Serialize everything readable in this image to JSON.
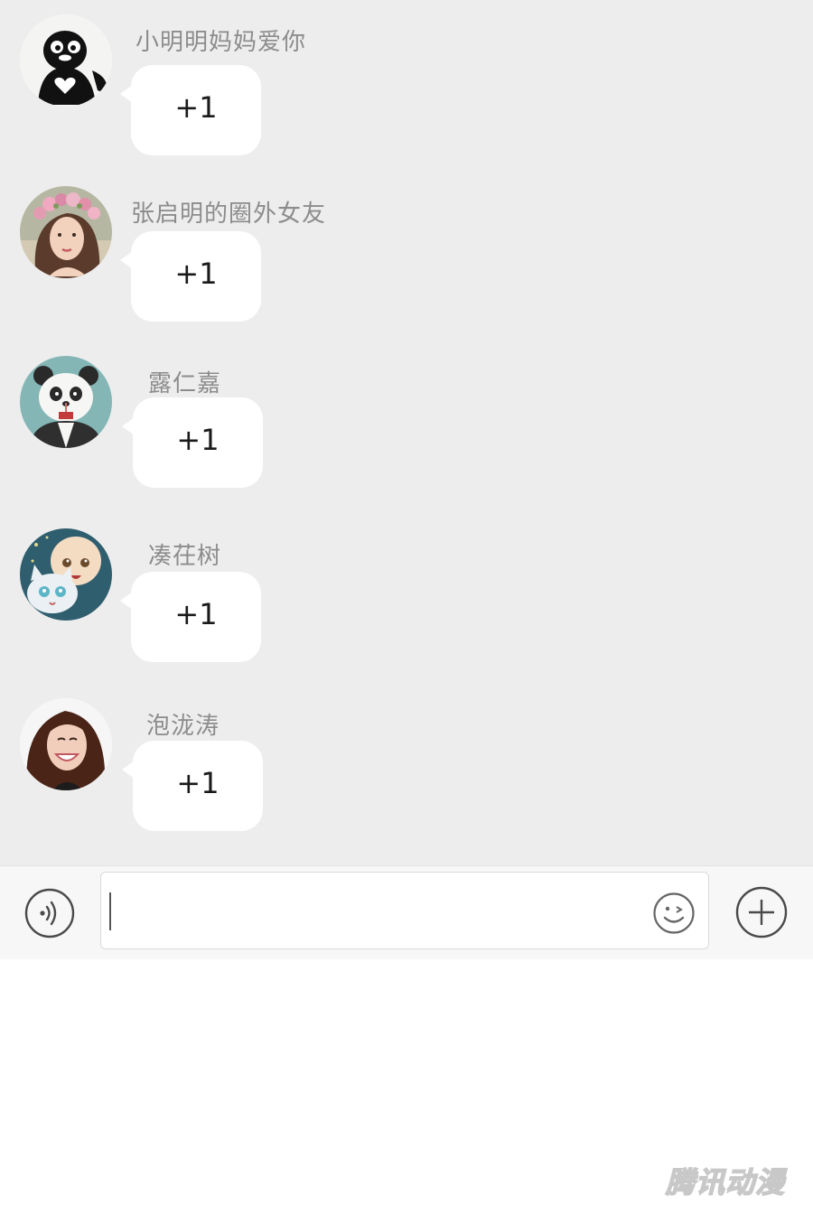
{
  "chat": {
    "messages": [
      {
        "sender": "小明明妈妈爱你",
        "text": "+1",
        "avatar_icon": "penguin-avatar-icon"
      },
      {
        "sender": "张启明的圈外女友",
        "text": "+1",
        "avatar_icon": "flower-crown-girl-avatar-icon"
      },
      {
        "sender": "露仁嘉",
        "text": "+1",
        "avatar_icon": "panda-avatar-icon"
      },
      {
        "sender": "凑茌树",
        "text": "+1",
        "avatar_icon": "chibi-characters-avatar-icon"
      },
      {
        "sender": "泡泷涛",
        "text": "+1",
        "avatar_icon": "smiling-woman-avatar-icon"
      }
    ]
  },
  "input_bar": {
    "value": "",
    "voice_icon": "voice-icon",
    "emoji_icon": "emoji-icon",
    "plus_icon": "plus-circle-icon"
  },
  "watermark": {
    "text": "腾讯动漫"
  },
  "colors": {
    "chat_background": "#ededed",
    "bubble": "#ffffff",
    "sender_text": "#8c8c8c",
    "input_bar": "#f7f7f7"
  }
}
